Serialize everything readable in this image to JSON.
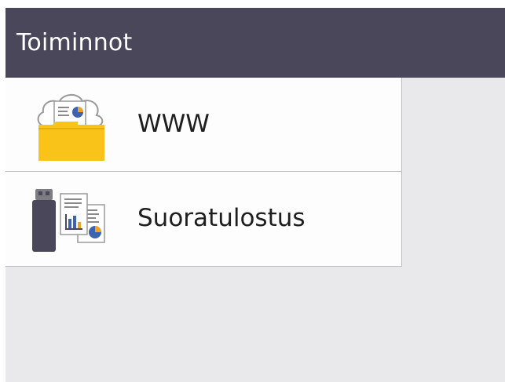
{
  "header": {
    "title": "Toiminnot"
  },
  "menu": {
    "items": [
      {
        "label": "WWW",
        "icon": "cloud-folder-icon"
      },
      {
        "label": "Suoratulostus",
        "icon": "usb-print-icon"
      }
    ]
  },
  "colors": {
    "header_bg": "#4b475b",
    "list_bg": "#fdfdfd",
    "screen_bg": "#e9e9eb",
    "folder_yellow": "#f9c31a",
    "accent_blue": "#3b63b0"
  }
}
